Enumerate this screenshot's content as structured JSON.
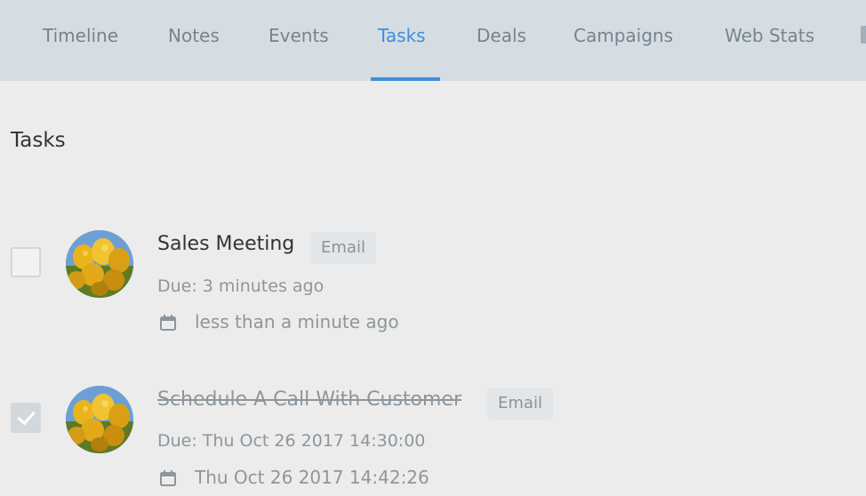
{
  "tabs": [
    {
      "label": "Timeline"
    },
    {
      "label": "Notes"
    },
    {
      "label": "Events"
    },
    {
      "label": "Tasks",
      "active": true
    },
    {
      "label": "Deals"
    },
    {
      "label": "Campaigns"
    },
    {
      "label": "Web Stats"
    }
  ],
  "section": {
    "title": "Tasks"
  },
  "tasks": [
    {
      "title": "Sales Meeting",
      "type": "Email",
      "due": "Due: 3 minutes ago",
      "created": "less than a minute ago",
      "completed": false
    },
    {
      "title": "Schedule A Call With Customer",
      "type": "Email",
      "due": "Due: Thu Oct 26 2017 14:30:00",
      "created": "Thu Oct 26 2017 14:42:26",
      "completed": true
    }
  ],
  "colors": {
    "accent": "#3d8ee0",
    "tab_bar": "#d6dde2",
    "background": "#ececec"
  }
}
